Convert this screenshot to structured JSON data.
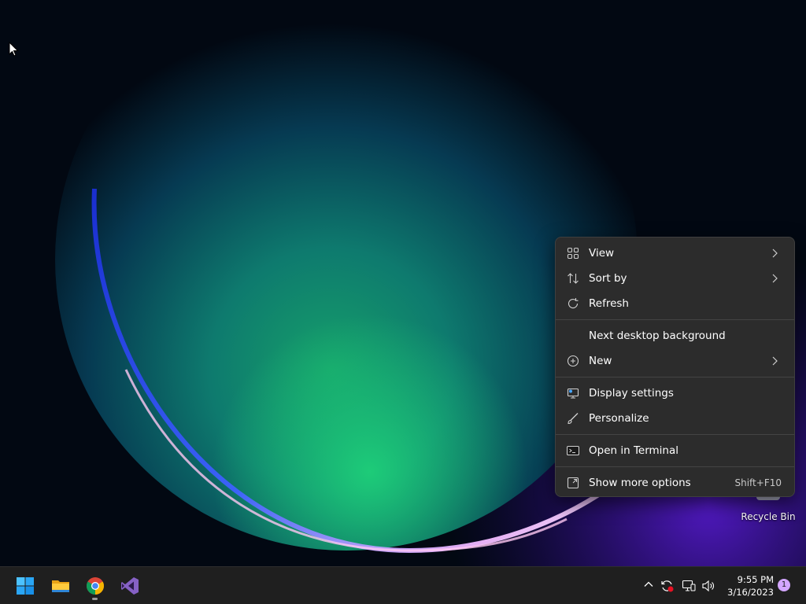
{
  "desktop": {
    "icons": [
      {
        "label": "Recycle Bin"
      }
    ]
  },
  "context_menu": {
    "items": [
      {
        "label": "View",
        "icon": "grid-view-icon",
        "submenu": true
      },
      {
        "label": "Sort by",
        "icon": "sort-icon",
        "submenu": true
      },
      {
        "label": "Refresh",
        "icon": "refresh-icon",
        "submenu": false
      },
      {
        "label": "Next desktop background",
        "icon": "",
        "submenu": false
      },
      {
        "label": "New",
        "icon": "plus-circle-icon",
        "submenu": true
      },
      {
        "label": "Display settings",
        "icon": "display-icon",
        "submenu": false
      },
      {
        "label": "Personalize",
        "icon": "brush-icon",
        "submenu": false
      },
      {
        "label": "Open in Terminal",
        "icon": "terminal-icon",
        "submenu": false
      },
      {
        "label": "Show more options",
        "icon": "expand-icon",
        "submenu": false,
        "shortcut": "Shift+F10"
      }
    ]
  },
  "taskbar": {
    "apps": [
      {
        "name": "Start",
        "icon": "windows-start-icon"
      },
      {
        "name": "File Explorer",
        "icon": "folder-icon"
      },
      {
        "name": "Google Chrome",
        "icon": "chrome-icon",
        "running": true
      },
      {
        "name": "Visual Studio",
        "icon": "visual-studio-icon"
      }
    ],
    "tray": {
      "icons": [
        "chevron-up-icon",
        "sync-error-icon",
        "network-icon",
        "volume-icon"
      ],
      "time": "9:55 PM",
      "date": "3/16/2023",
      "notification_count": "1"
    }
  },
  "colors": {
    "menu_bg": "#2c2c2c",
    "taskbar_bg": "#1f1f1f",
    "notification_badge": "#d3a6ff"
  }
}
